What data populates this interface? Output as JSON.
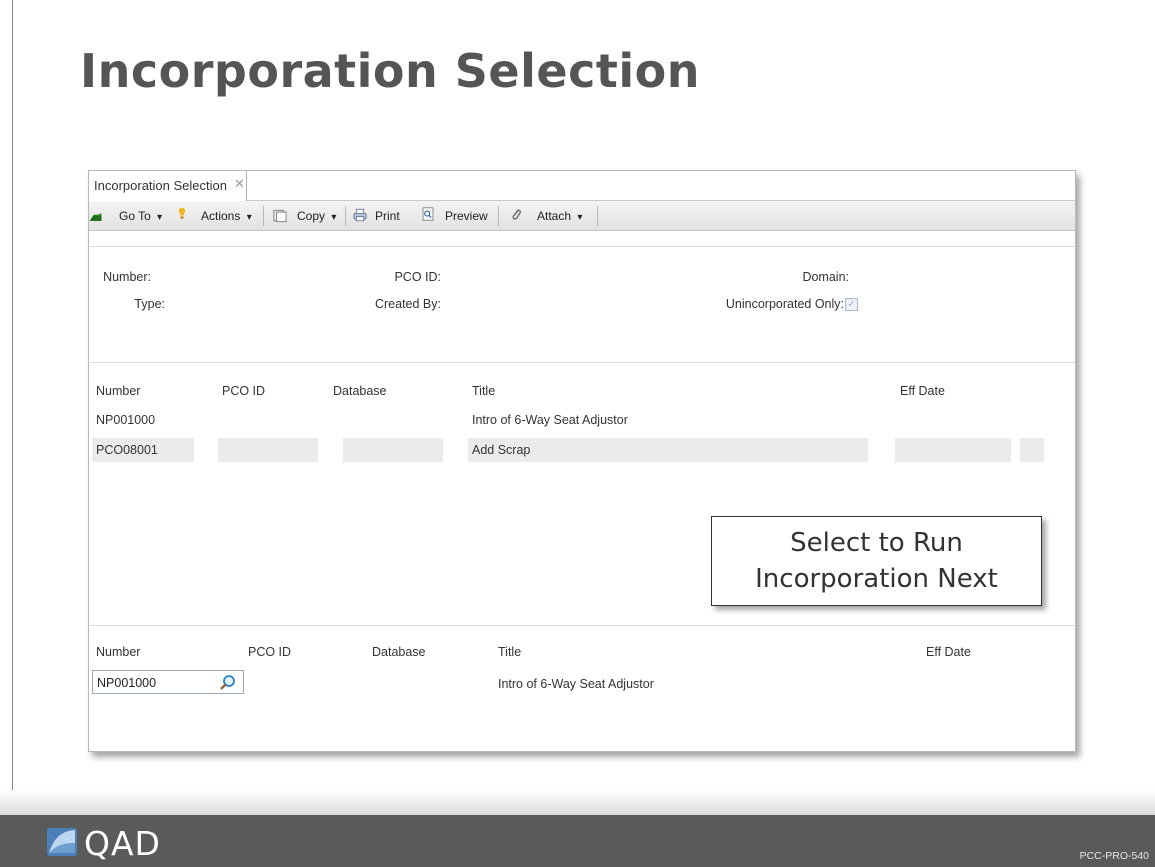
{
  "slide": {
    "title": "Incorporation Selection",
    "code": "PCC-PRO-540",
    "brand": "QAD"
  },
  "window": {
    "tab_label": "Incorporation Selection",
    "close_glyph": "✕"
  },
  "toolbar": {
    "goto": "Go To",
    "actions": "Actions",
    "copy": "Copy",
    "print": "Print",
    "preview": "Preview",
    "attach": "Attach",
    "dropdown_glyph": "▾"
  },
  "filters": {
    "number_label": "Number:",
    "type_label": "Type:",
    "pco_id_label": "PCO ID:",
    "created_by_label": "Created By:",
    "domain_label": "Domain:",
    "unincorporated_label": "Unincorporated Only:",
    "unincorporated_checked": true,
    "check_glyph": "✓"
  },
  "grid": {
    "headers": {
      "number": "Number",
      "pco_id": "PCO ID",
      "database": "Database",
      "title": "Title",
      "eff_date": "Eff Date"
    },
    "rows": [
      {
        "number": "NP001000",
        "pco_id": "",
        "database": "",
        "title": "Intro of 6-Way Seat Adjustor",
        "eff_date": ""
      },
      {
        "number": "PCO08001",
        "pco_id": "",
        "database": "",
        "title": "Add Scrap",
        "eff_date": ""
      }
    ]
  },
  "callout": {
    "line1": "Select to Run",
    "line2": "Incorporation Next"
  },
  "next": {
    "headers": {
      "number": "Number",
      "pco_id": "PCO ID",
      "database": "Database",
      "title": "Title",
      "eff_date": "Eff Date"
    },
    "number_value": "NP001000",
    "title_value": "Intro of 6-Way Seat Adjustor"
  },
  "colors": {
    "title_gray": "#555555",
    "footer_bg": "#5a5a5a"
  }
}
